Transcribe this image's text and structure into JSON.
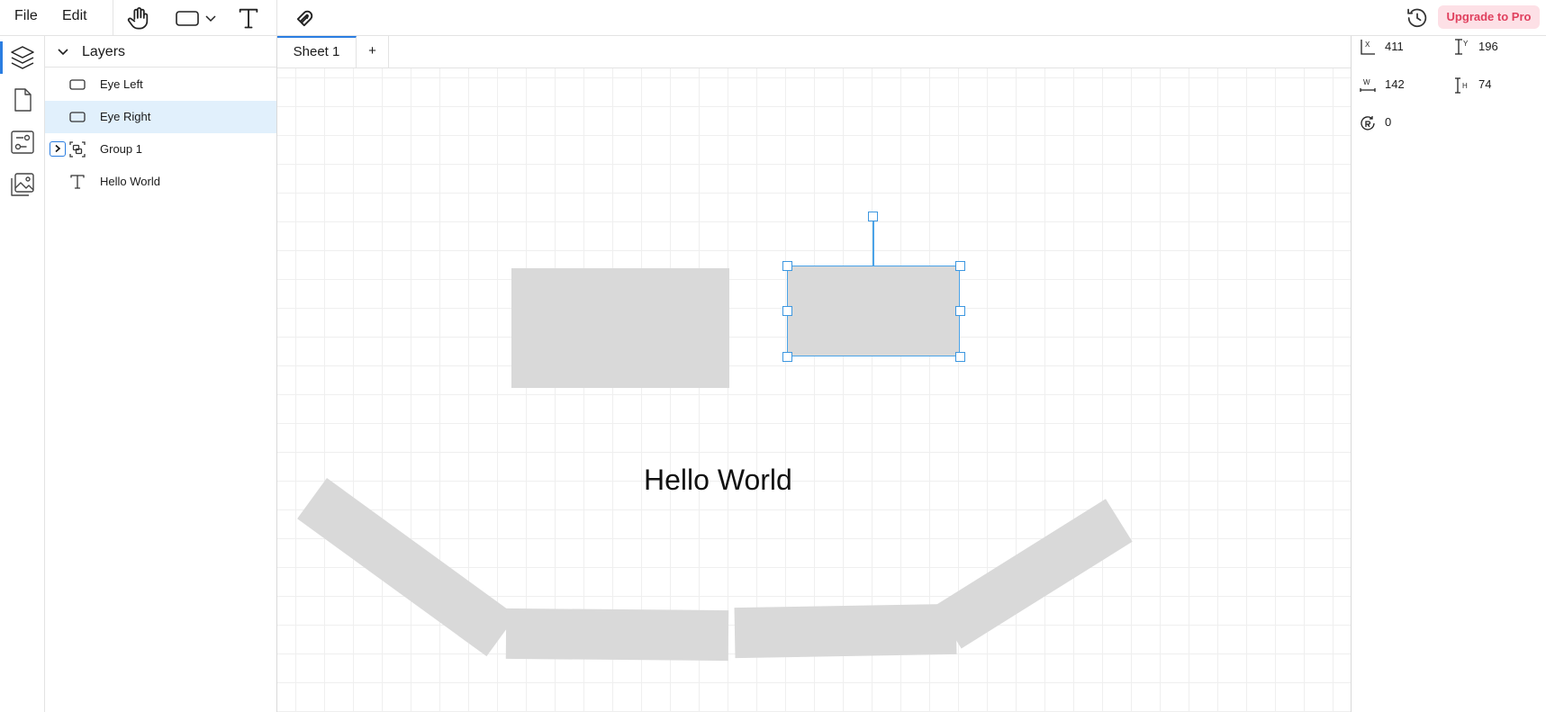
{
  "menu": {
    "file": "File",
    "edit": "Edit"
  },
  "toolbar": {
    "tools": [
      "hand-icon",
      "rectangle-icon",
      "chevron-down-icon",
      "text-icon",
      "magnet-icon"
    ],
    "history_icon": "history-icon",
    "upgrade_label": "Upgrade to Pro"
  },
  "rail": {
    "items": [
      "layers-icon",
      "page-icon",
      "components-icon",
      "images-icon"
    ]
  },
  "layers": {
    "title": "Layers",
    "items": [
      {
        "label": "Eye Left",
        "icon": "rectangle-icon",
        "selected": false
      },
      {
        "label": "Eye Right",
        "icon": "rectangle-icon",
        "selected": true
      },
      {
        "label": "Group 1",
        "icon": "group-icon",
        "selected": false,
        "collapsed": true
      },
      {
        "label": "Hello World",
        "icon": "text-icon",
        "selected": false
      }
    ]
  },
  "tabs": {
    "items": [
      {
        "label": "Sheet 1",
        "active": true
      }
    ],
    "add_label": "+"
  },
  "canvas": {
    "text": "Hello World"
  },
  "properties": {
    "x_label": "X",
    "x": "411",
    "y_label": "Y",
    "y": "196",
    "w_label": "W",
    "w": "142",
    "h_label": "H",
    "h": "74",
    "rotation": "0"
  },
  "colors": {
    "accent": "#2a7de1",
    "selection": "#4aa3e8",
    "selected_row": "#e1f0fc",
    "shape_fill": "#d9d9d9",
    "upgrade_bg": "#fde0e6",
    "upgrade_text": "#e0405e"
  }
}
